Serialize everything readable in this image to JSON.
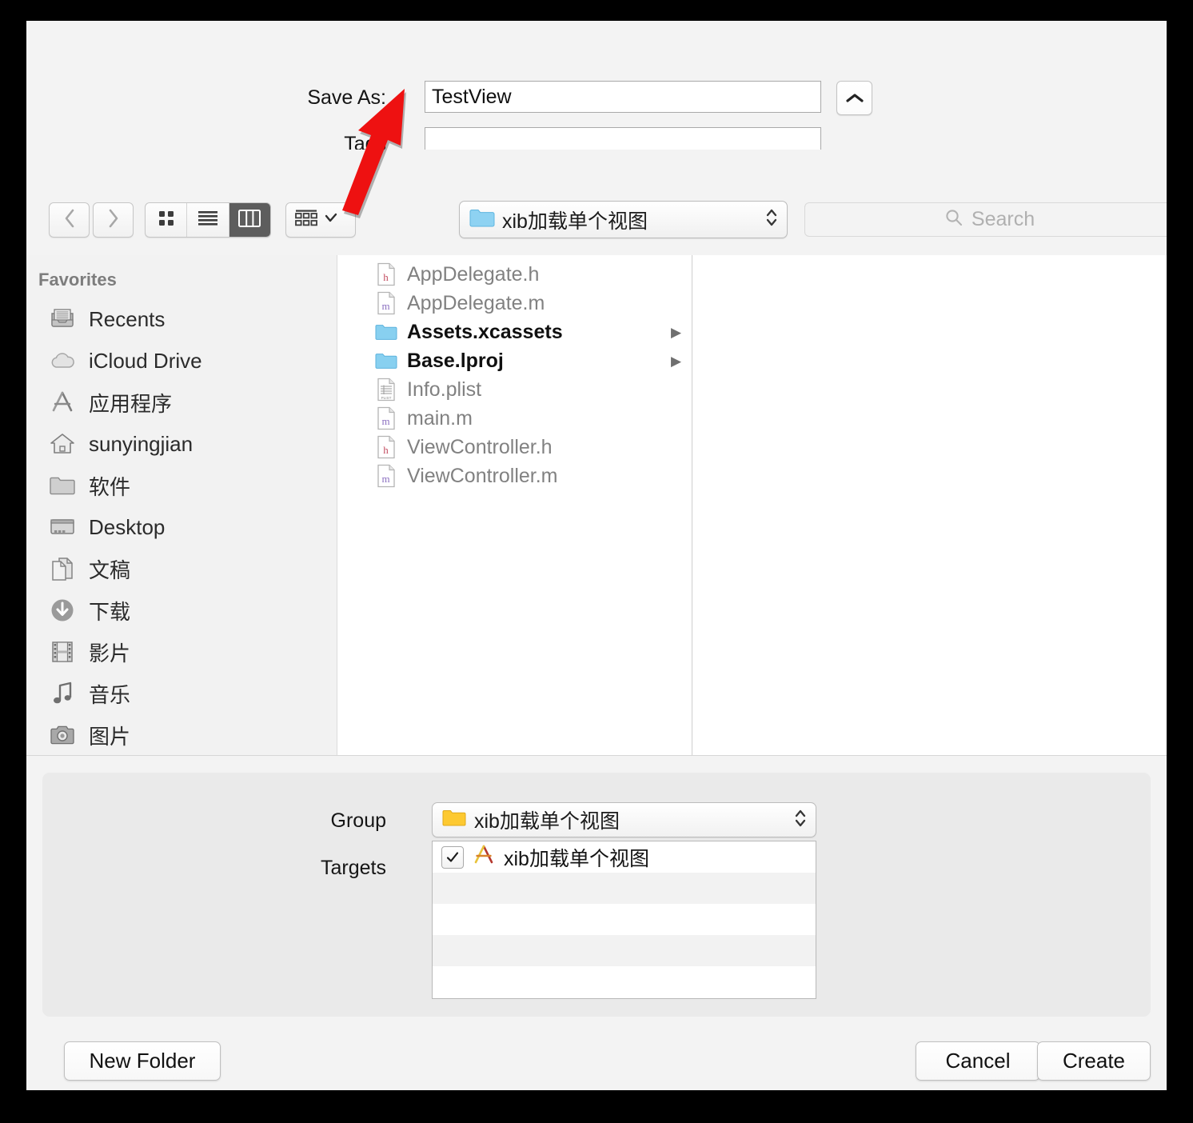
{
  "dialog": {
    "save_as_label": "Save As:",
    "save_as_value": "TestView",
    "tags_label": "Tags",
    "tags_value": "",
    "expand_icon": "chevron-up-icon"
  },
  "toolbar": {
    "back_icon": "chevron-left-icon",
    "forward_icon": "chevron-right-icon",
    "view_modes": [
      {
        "name": "icon-view",
        "icon": "grid-icon",
        "active": false
      },
      {
        "name": "list-view",
        "icon": "list-icon",
        "active": false
      },
      {
        "name": "column-view",
        "icon": "columns-icon",
        "active": true
      }
    ],
    "arrange_icon": "arrange-by-icon",
    "arrange_chevron_icon": "chevron-down-icon",
    "path_popup": {
      "icon": "folder-icon",
      "label": "xib加载单个视图",
      "stepper_icon": "up-down-chevron-icon"
    },
    "search": {
      "icon": "search-icon",
      "placeholder": "Search",
      "value": ""
    }
  },
  "sidebar": {
    "header": "Favorites",
    "items": [
      {
        "icon": "recents-icon",
        "label": "Recents"
      },
      {
        "icon": "icloud-icon",
        "label": "iCloud Drive"
      },
      {
        "icon": "applications-icon",
        "label": "应用程序"
      },
      {
        "icon": "home-icon",
        "label": "sunyingjian"
      },
      {
        "icon": "folder-icon",
        "label": "软件"
      },
      {
        "icon": "desktop-icon",
        "label": "Desktop"
      },
      {
        "icon": "documents-icon",
        "label": "文稿"
      },
      {
        "icon": "downloads-icon",
        "label": "下载"
      },
      {
        "icon": "movies-icon",
        "label": "影片"
      },
      {
        "icon": "music-icon",
        "label": "音乐"
      },
      {
        "icon": "pictures-icon",
        "label": "图片"
      }
    ]
  },
  "file_list": [
    {
      "name": "AppDelegate.h",
      "icon": "h-file-icon",
      "type": "file",
      "disclosure": false
    },
    {
      "name": "AppDelegate.m",
      "icon": "m-file-icon",
      "type": "file",
      "disclosure": false
    },
    {
      "name": "Assets.xcassets",
      "icon": "folder-icon",
      "type": "folder",
      "disclosure": true
    },
    {
      "name": "Base.lproj",
      "icon": "folder-icon",
      "type": "folder",
      "disclosure": true
    },
    {
      "name": "Info.plist",
      "icon": "plist-file-icon",
      "type": "file",
      "disclosure": false
    },
    {
      "name": "main.m",
      "icon": "m-file-icon",
      "type": "file",
      "disclosure": false
    },
    {
      "name": "ViewController.h",
      "icon": "h-file-icon",
      "type": "file",
      "disclosure": false
    },
    {
      "name": "ViewController.m",
      "icon": "m-file-icon",
      "type": "file",
      "disclosure": false
    }
  ],
  "accessory": {
    "group_label": "Group",
    "group_value": "xib加载单个视图",
    "group_icon": "yellow-folder-icon",
    "targets_label": "Targets",
    "targets": [
      {
        "label": "xib加载单个视图",
        "checked": true,
        "icon": "xcode-icon"
      }
    ]
  },
  "bottom_bar": {
    "new_folder_label": "New Folder",
    "cancel_label": "Cancel",
    "create_label": "Create"
  },
  "annotation": {
    "type": "red-arrow",
    "color": "#ee1111",
    "points_to": "save-as-input"
  }
}
